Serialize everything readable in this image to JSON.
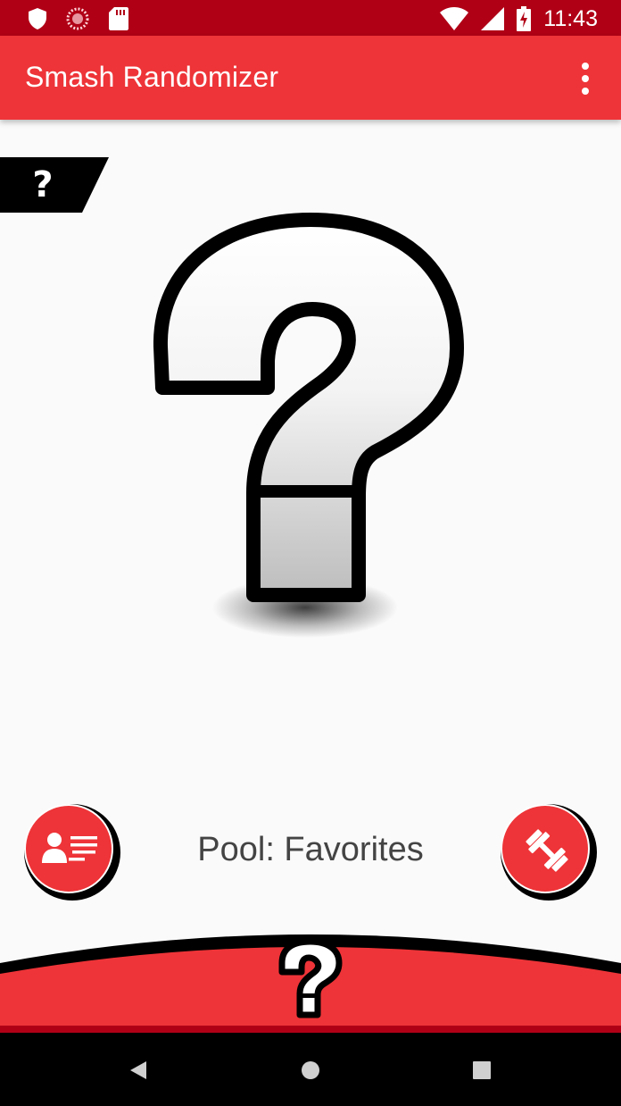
{
  "status_bar": {
    "time": "11:43",
    "icons": [
      "shield-icon",
      "loading-icon",
      "sd-card-icon",
      "wifi-icon",
      "signal-icon",
      "battery-charging-icon"
    ]
  },
  "app_bar": {
    "title": "Smash Randomizer",
    "menu_icon": "more-vert-icon"
  },
  "character": {
    "tag": "?",
    "image_icon": "question-mark-icon"
  },
  "controls": {
    "pool_label": "Pool: Favorites",
    "left_button_icon": "character-list-icon",
    "right_button_icon": "dumbbell-icon"
  },
  "bottom": {
    "randomize_icon": "question-mark-icon"
  },
  "nav": {
    "back_icon": "back-icon",
    "home_icon": "home-icon",
    "recents_icon": "recents-icon"
  },
  "colors": {
    "status_bar": "#b00016",
    "primary": "#ee3438",
    "background": "#fafafa"
  }
}
